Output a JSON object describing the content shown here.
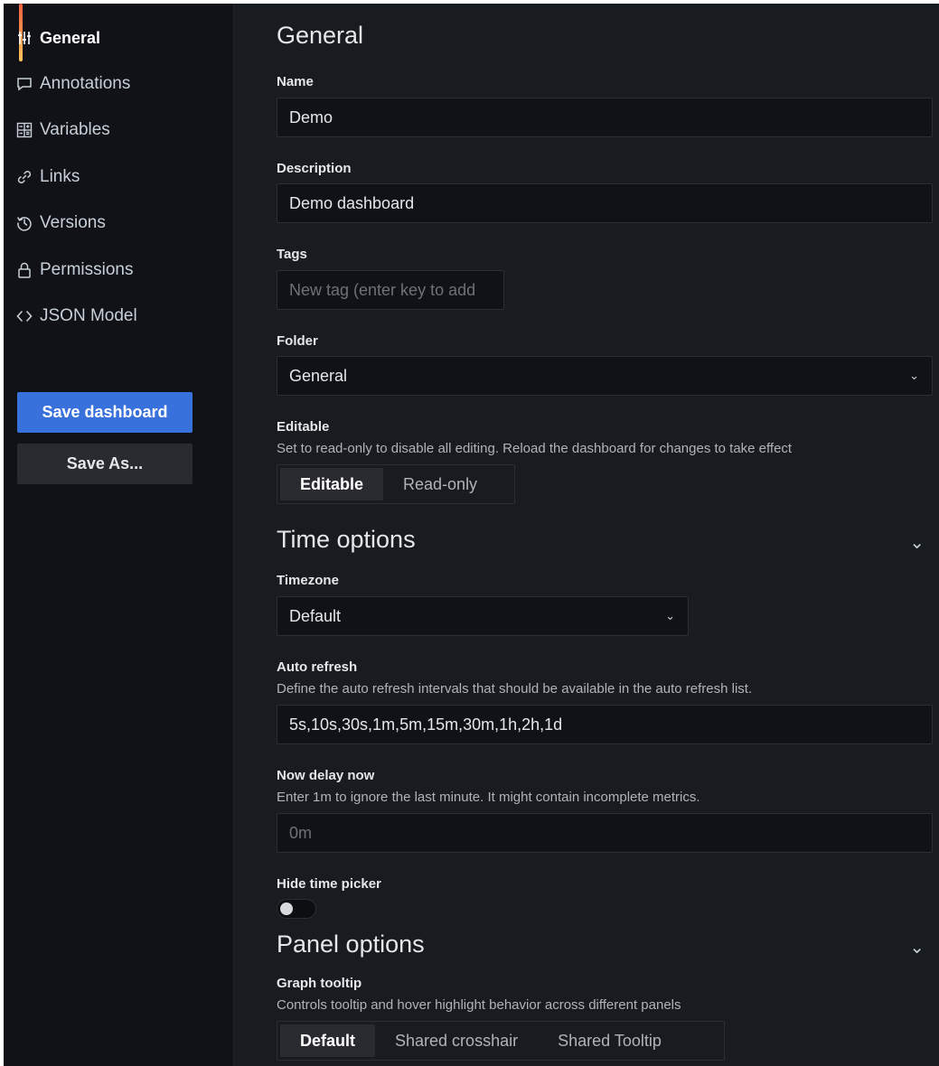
{
  "sidebar": {
    "items": [
      {
        "label": "General",
        "icon": "sliders-icon"
      },
      {
        "label": "Annotations",
        "icon": "comment-icon"
      },
      {
        "label": "Variables",
        "icon": "calculator-icon"
      },
      {
        "label": "Links",
        "icon": "link-icon"
      },
      {
        "label": "Versions",
        "icon": "history-icon"
      },
      {
        "label": "Permissions",
        "icon": "lock-icon"
      },
      {
        "label": "JSON Model",
        "icon": "code-icon"
      }
    ],
    "save_label": "Save dashboard",
    "save_as_label": "Save As..."
  },
  "general": {
    "title": "General",
    "name_label": "Name",
    "name_value": "Demo",
    "description_label": "Description",
    "description_value": "Demo dashboard",
    "tags_label": "Tags",
    "tags_placeholder": "New tag (enter key to add",
    "folder_label": "Folder",
    "folder_value": "General",
    "editable_label": "Editable",
    "editable_desc": "Set to read-only to disable all editing. Reload the dashboard for changes to take effect",
    "editable_options": [
      "Editable",
      "Read-only"
    ],
    "editable_selected": "Editable"
  },
  "time_options": {
    "title": "Time options",
    "timezone_label": "Timezone",
    "timezone_value": "Default",
    "auto_refresh_label": "Auto refresh",
    "auto_refresh_desc": "Define the auto refresh intervals that should be available in the auto refresh list.",
    "auto_refresh_value": "5s,10s,30s,1m,5m,15m,30m,1h,2h,1d",
    "now_delay_label": "Now delay now",
    "now_delay_desc": "Enter 1m to ignore the last minute. It might contain incomplete metrics.",
    "now_delay_placeholder": "0m",
    "hide_time_picker_label": "Hide time picker",
    "hide_time_picker_on": false
  },
  "panel_options": {
    "title": "Panel options",
    "graph_tooltip_label": "Graph tooltip",
    "graph_tooltip_desc": "Controls tooltip and hover highlight behavior across different panels",
    "graph_tooltip_options": [
      "Default",
      "Shared crosshair",
      "Shared Tooltip"
    ],
    "graph_tooltip_selected": "Default"
  },
  "colors": {
    "background": "#181b1f",
    "sidebar": "#111217",
    "primary": "#3871dc",
    "active_gradient_top": "#f55f3e",
    "active_gradient_bottom": "#fbc55a"
  }
}
